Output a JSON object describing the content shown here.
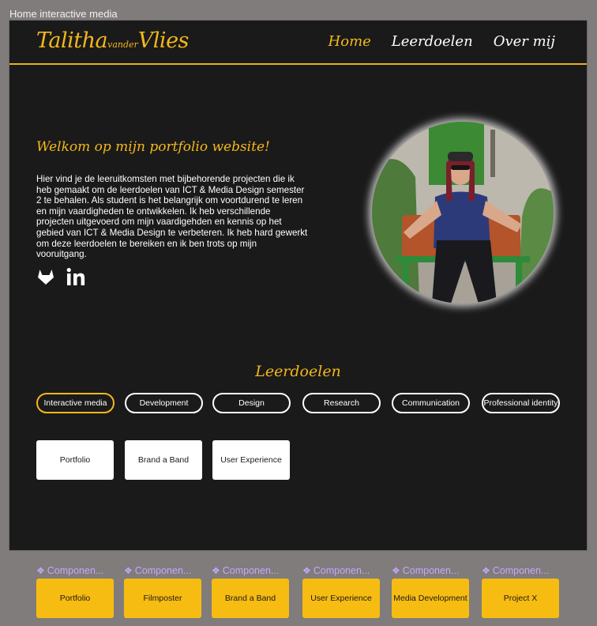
{
  "frame": {
    "label": "Home interactive media"
  },
  "header": {
    "logo": {
      "first": "Talitha",
      "middle": "vander",
      "last": "Vlies"
    },
    "nav": [
      {
        "label": "Home",
        "active": true
      },
      {
        "label": "Leerdoelen",
        "active": false
      },
      {
        "label": "Over mij",
        "active": false
      }
    ]
  },
  "intro": {
    "title": "Welkom op mijn portfolio website!",
    "text": "Hier vind je de leeruitkomsten met bijbehorende projecten die ik heb gemaakt om de leerdoelen van ICT & Media Design semester 2 te behalen. Als student is het belangrijk om voortdurend te leren en mijn vaardigheden te ontwikkelen. Ik heb verschillende projecten uitgevoerd om mijn vaardigehden en kennis op het gebied van ICT & Media Design te verbeteren. Ik heb hard gewerkt om deze leerdoelen te bereiken en ik ben trots op mijn vooruitgang.",
    "socials": [
      "gitlab-icon",
      "linkedin-icon"
    ]
  },
  "learning_goals": {
    "title": "Leerdoelen",
    "tabs": [
      {
        "label": "Interactive media",
        "active": true
      },
      {
        "label": "Development",
        "active": false
      },
      {
        "label": "Design",
        "active": false
      },
      {
        "label": "Research",
        "active": false
      },
      {
        "label": "Communication",
        "active": false
      },
      {
        "label": "Professional identity",
        "active": false
      }
    ],
    "cards": [
      "Portfolio",
      "Brand a Band",
      "User Experience"
    ]
  },
  "components": {
    "label": "Componen...",
    "items": [
      "Portfolio",
      "Filmposter",
      "Brand a Band",
      "User Experience",
      "Media Development",
      "Project X"
    ]
  },
  "colors": {
    "accent": "#f2b81c",
    "background": "#1b1a1a",
    "canvas": "#7f7c7b",
    "component": "#f7bc12",
    "component_label": "#c9a5ff"
  }
}
